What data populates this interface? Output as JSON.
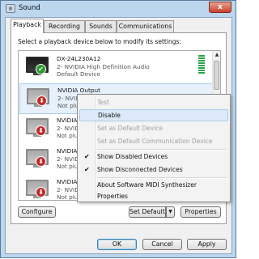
{
  "window": {
    "title": "Sound",
    "close_glyph": "x"
  },
  "tabs": [
    {
      "label": "Playback"
    },
    {
      "label": "Recording"
    },
    {
      "label": "Sounds"
    },
    {
      "label": "Communications"
    }
  ],
  "instructions": "Select a playback device below to modify its settings:",
  "devices": [
    {
      "name": "DX-24L230A12",
      "driver": "2- NVIDIA High Definition Audio",
      "state": "Default Device",
      "icon": "monitor-dark",
      "status_icon": "check-icon"
    },
    {
      "name": "NVIDIA Output",
      "driver": "2- NVIDIA",
      "state": "Not plug",
      "icon": "monitor-gray",
      "status_icon": "down-arrow-icon"
    },
    {
      "name": "NVIDIA O",
      "driver": "2- NVIDIA",
      "state": "Not plug",
      "icon": "monitor-gray",
      "status_icon": "down-arrow-icon"
    },
    {
      "name": "NVIDIA O",
      "driver": "2- NVIDIA",
      "state": "Not plug",
      "icon": "monitor-gray",
      "status_icon": "down-arrow-icon"
    },
    {
      "name": "NVIDIA O",
      "driver": "2- NVIDIA",
      "state": "Not plug",
      "icon": "monitor-gray",
      "status_icon": "down-arrow-icon"
    }
  ],
  "context_menu": {
    "items": [
      {
        "label": "Test",
        "enabled": false,
        "checked": false
      },
      {
        "label": "Disable",
        "enabled": true,
        "checked": false,
        "highlighted": true
      },
      {
        "label": "Set as Default Device",
        "enabled": false,
        "checked": false
      },
      {
        "label": "Set as Default Communication Device",
        "enabled": false,
        "checked": false
      },
      {
        "label": "Show Disabled Devices",
        "enabled": true,
        "checked": true
      },
      {
        "label": "Show Disconnected Devices",
        "enabled": true,
        "checked": true
      },
      {
        "label": "About Software MIDI Synthesizer",
        "enabled": true,
        "checked": false
      },
      {
        "label": "Properties",
        "enabled": true,
        "checked": false
      }
    ]
  },
  "buttons": {
    "configure": "Configure",
    "set_default": "Set Default",
    "properties": "Properties",
    "ok": "OK",
    "cancel": "Cancel",
    "apply": "Apply"
  },
  "glyphs": {
    "check": "✔",
    "down_arrow": "⬇",
    "scroll_up": "▲",
    "scroll_down": "▼",
    "split_arrow": "▼"
  },
  "colors": {
    "selection": "#dbe9f8",
    "default_status": "#2a9a2a",
    "unplugged_status": "#c22a2a",
    "level_meter": "#2aa44a"
  }
}
